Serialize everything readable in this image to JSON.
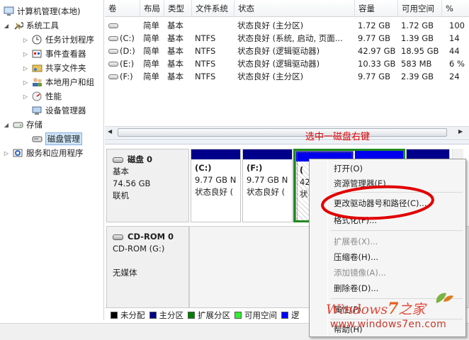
{
  "tree": {
    "items": [
      {
        "label": "计算机管理(本地)",
        "icon": "computer-management-icon",
        "expander": ""
      },
      {
        "label": "系统工具",
        "icon": "system-tools-icon",
        "expander": "◢"
      },
      {
        "label": "任务计划程序",
        "icon": "task-scheduler-icon",
        "expander": "▷"
      },
      {
        "label": "事件查看器",
        "icon": "event-viewer-icon",
        "expander": "▷"
      },
      {
        "label": "共享文件夹",
        "icon": "shared-folders-icon",
        "expander": "▷"
      },
      {
        "label": "本地用户和组",
        "icon": "local-users-icon",
        "expander": "▷"
      },
      {
        "label": "性能",
        "icon": "performance-icon",
        "expander": "▷"
      },
      {
        "label": "设备管理器",
        "icon": "device-manager-icon",
        "expander": ""
      },
      {
        "label": "存储",
        "icon": "storage-icon",
        "expander": "◢"
      },
      {
        "label": "磁盘管理",
        "icon": "disk-management-icon",
        "expander": ""
      },
      {
        "label": "服务和应用程序",
        "icon": "services-apps-icon",
        "expander": "▷"
      }
    ]
  },
  "volumes": {
    "columns": [
      "卷",
      "布局",
      "类型",
      "文件系统",
      "状态",
      "容量",
      "可用空间",
      "%"
    ],
    "rows": [
      {
        "vol": "",
        "layout": "简单",
        "type": "基本",
        "fs": "",
        "status": "状态良好 (主分区)",
        "cap": "1.72 GB",
        "free": "1.72 GB",
        "pct": "100"
      },
      {
        "vol": "(C:)",
        "layout": "简单",
        "type": "基本",
        "fs": "NTFS",
        "status": "状态良好 (系统, 启动, 页面...",
        "cap": "9.77 GB",
        "free": "1.39 GB",
        "pct": "14"
      },
      {
        "vol": "(D:)",
        "layout": "简单",
        "type": "基本",
        "fs": "NTFS",
        "status": "状态良好 (逻辑驱动器)",
        "cap": "42.97 GB",
        "free": "18.95 GB",
        "pct": "44"
      },
      {
        "vol": "(E:)",
        "layout": "简单",
        "type": "基本",
        "fs": "NTFS",
        "status": "状态良好 (逻辑驱动器)",
        "cap": "10.33 GB",
        "free": "583 MB",
        "pct": "6 %"
      },
      {
        "vol": "(F:)",
        "layout": "简单",
        "type": "基本",
        "fs": "NTFS",
        "status": "状态良好 (主分区)",
        "cap": "9.77 GB",
        "free": "2.39 GB",
        "pct": "24"
      }
    ]
  },
  "disk0": {
    "name": "磁盘 0",
    "kind": "基本",
    "size": "74.56 GB",
    "state": "联机",
    "partitions": [
      {
        "label": "(C:)",
        "size": "9.77 GB N",
        "status": "状态良好 ("
      },
      {
        "label": "(F:)",
        "size": "9.77 GB N",
        "status": "状态良好 ("
      },
      {
        "label": "(",
        "size": "42",
        "status": "状"
      }
    ]
  },
  "cdrom": {
    "name": "CD-ROM 0",
    "device": "CD-ROM (G:)",
    "media": "无媒体"
  },
  "legend": [
    {
      "label": "未分配",
      "color": "#000000"
    },
    {
      "label": "主分区",
      "color": "#00008b"
    },
    {
      "label": "扩展分区",
      "color": "#008000"
    },
    {
      "label": "可用空间",
      "color": "#33ee33"
    },
    {
      "label": "逻",
      "color": "#0000ff"
    }
  ],
  "context_menu": {
    "items": [
      {
        "label": "打开(O)",
        "enabled": true
      },
      {
        "label": "资源管理器(E)",
        "enabled": true
      },
      {
        "label": "更改驱动器号和路径(C)...",
        "enabled": true
      },
      {
        "label": "格式化(F)...",
        "enabled": true
      },
      {
        "label": "扩展卷(X)...",
        "enabled": false
      },
      {
        "label": "压缩卷(H)...",
        "enabled": true
      },
      {
        "label": "添加镜像(A)...",
        "enabled": false
      },
      {
        "label": "删除卷(D)...",
        "enabled": true
      },
      {
        "label": "属性(P)",
        "enabled": true
      },
      {
        "label": "帮助(H)",
        "enabled": true
      }
    ]
  },
  "annotation": {
    "callout": "选中一磁盘右键",
    "color": "#e00000"
  },
  "watermark": {
    "brand": "Windows",
    "seven": "7",
    "suffix": "之家",
    "url": "www.windows7en.com"
  }
}
